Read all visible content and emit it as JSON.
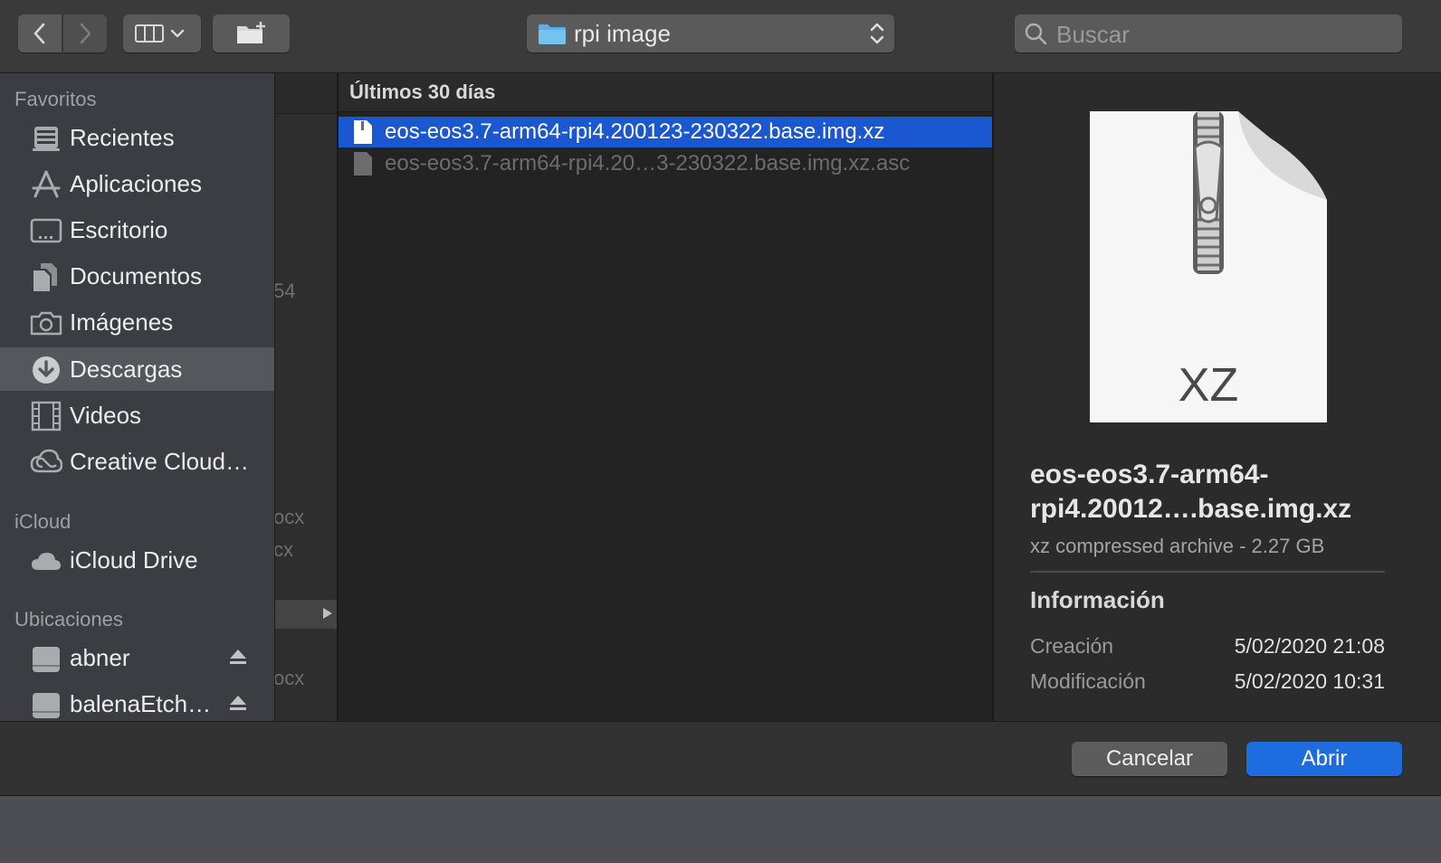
{
  "toolbar": {
    "back_icon": "chevron-left-icon",
    "forward_icon": "chevron-right-icon",
    "view_icon": "column-view-icon",
    "new_folder_icon": "new-folder-icon",
    "location": "rpi image",
    "search_placeholder": "Buscar"
  },
  "sidebar": {
    "favorites_title": "Favoritos",
    "favorites": [
      {
        "label": "Recientes",
        "icon": "recents-icon"
      },
      {
        "label": "Aplicaciones",
        "icon": "applications-icon"
      },
      {
        "label": "Escritorio",
        "icon": "desktop-icon"
      },
      {
        "label": "Documentos",
        "icon": "documents-icon"
      },
      {
        "label": "Imágenes",
        "icon": "camera-icon"
      },
      {
        "label": "Descargas",
        "icon": "downloads-icon",
        "selected": true
      },
      {
        "label": "Videos",
        "icon": "film-icon"
      },
      {
        "label": "Creative Cloud…",
        "icon": "creative-cloud-icon"
      }
    ],
    "icloud_title": "iCloud",
    "icloud": [
      {
        "label": "iCloud Drive",
        "icon": "cloud-icon"
      }
    ],
    "locations_title": "Ubicaciones",
    "locations": [
      {
        "label": "abner",
        "icon": "disk-icon",
        "eject": true
      },
      {
        "label": "balenaEtch…",
        "icon": "disk-icon",
        "eject": true
      }
    ]
  },
  "previous_column": {
    "fragments": [
      "54",
      "ocx",
      "cx",
      "ocx"
    ]
  },
  "file_column": {
    "header": "Últimos 30 días",
    "files": [
      {
        "name": "eos-eos3.7-arm64-rpi4.200123-230322.base.img.xz",
        "selected": true,
        "enabled": true
      },
      {
        "name": "eos-eos3.7-arm64-rpi4.20…3-230322.base.img.xz.asc",
        "selected": false,
        "enabled": false
      }
    ]
  },
  "preview": {
    "icon_label": "XZ",
    "title": "eos-eos3.7-arm64-rpi4.20012….base.img.xz",
    "kind": "xz compressed archive - 2.27 GB",
    "info_title": "Información",
    "rows": [
      {
        "key": "Creación",
        "value": "5/02/2020 21:08"
      },
      {
        "key": "Modificación",
        "value": "5/02/2020 10:31"
      }
    ]
  },
  "buttons": {
    "cancel": "Cancelar",
    "open": "Abrir"
  },
  "colors": {
    "accent": "#1f6be0",
    "selection": "#1b57d1"
  }
}
